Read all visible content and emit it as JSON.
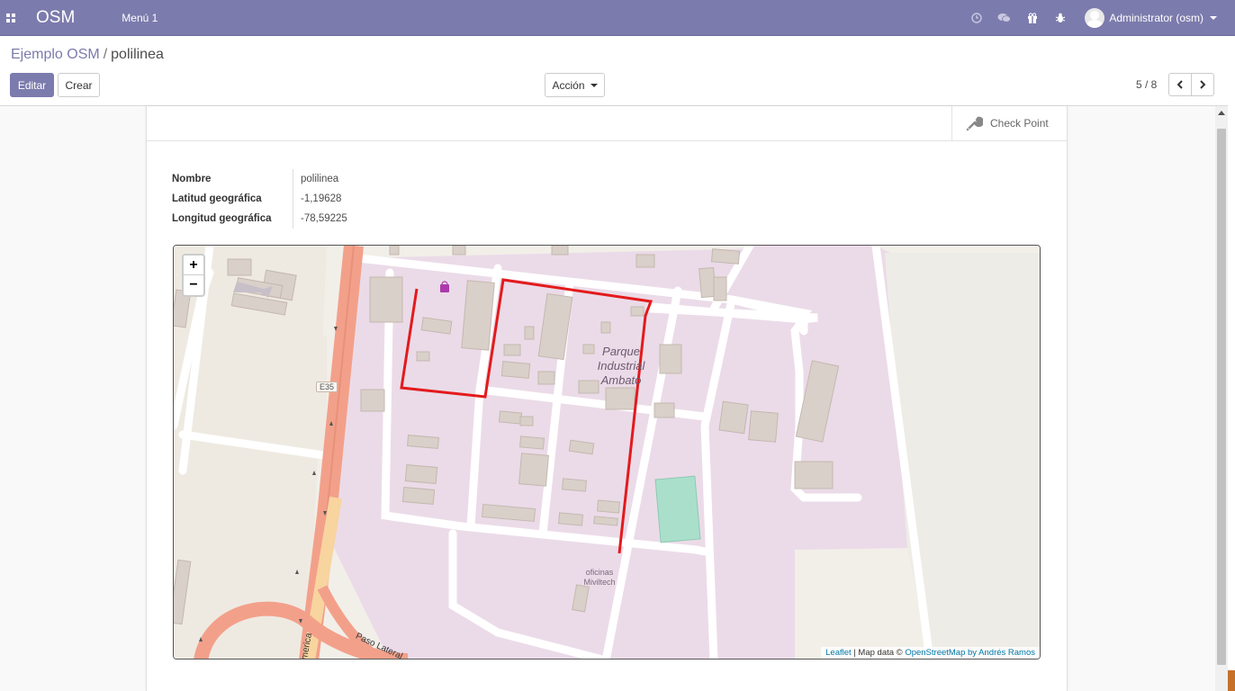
{
  "navbar": {
    "brand": "OSM",
    "menu_label": "Menú 1",
    "user_name": "Administrator (osm)",
    "icons": [
      "clock-icon",
      "chat-icon",
      "gift-icon",
      "bug-icon"
    ],
    "bg_color": "#7c7bad"
  },
  "breadcrumb": {
    "parent": "Ejemplo OSM",
    "separator": "/",
    "current": "polilinea"
  },
  "toolbar": {
    "edit_label": "Editar",
    "create_label": "Crear",
    "action_label": "Acción"
  },
  "pager": {
    "value": "5 / 8"
  },
  "button_box": {
    "checkpoint_label": "Check Point"
  },
  "fields": [
    {
      "label": "Nombre",
      "value": "polilinea"
    },
    {
      "label": "Latitud geográfica",
      "value": "-1,19628"
    },
    {
      "label": "Longitud geográfica",
      "value": "-78,59225"
    }
  ],
  "map": {
    "zoom_in": "+",
    "zoom_out": "−",
    "road_ref": "E35",
    "area_label": "Parque Industrial Ambato",
    "poi_label": "oficinas Miviltech",
    "street_label": "Paso Lateral",
    "street_label_2": "merica",
    "attribution_leaflet": "Leaflet",
    "attribution_sep": " | Map data © ",
    "attribution_osm": "OpenStreetMap by Andrés Ramos",
    "polyline_color": "#e31a1c"
  }
}
